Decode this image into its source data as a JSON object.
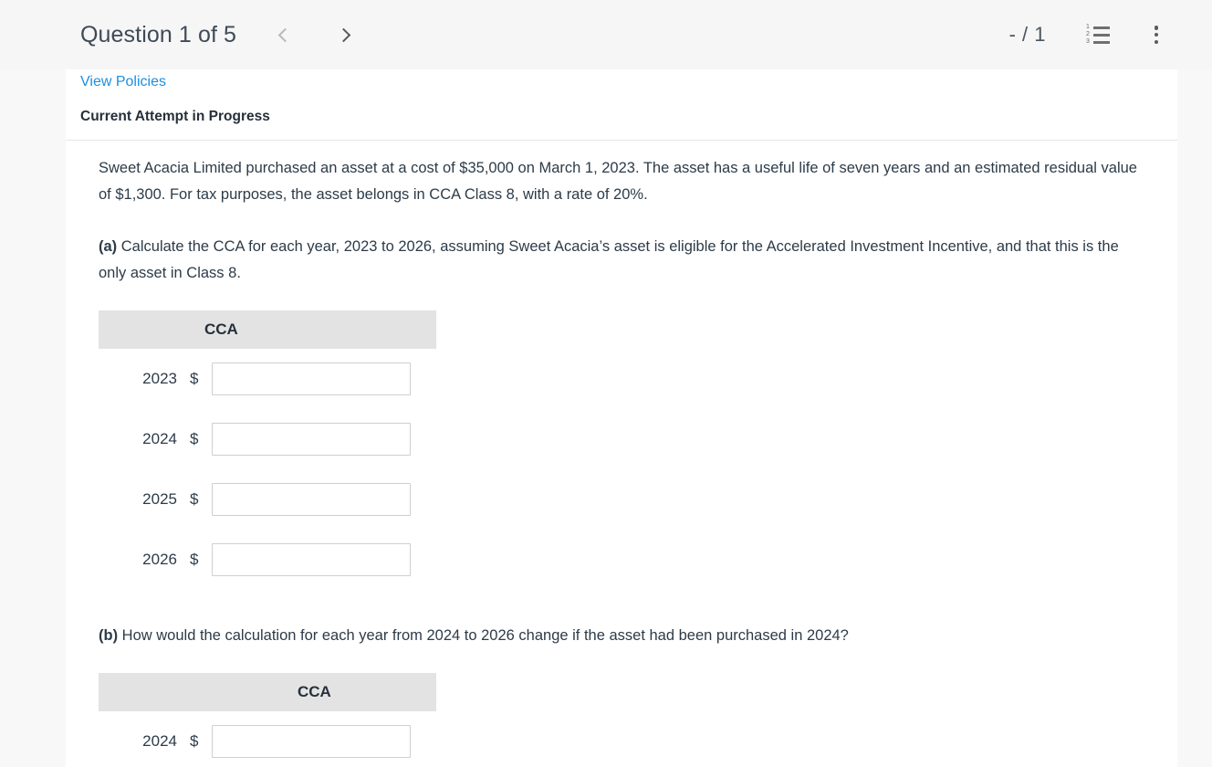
{
  "header": {
    "question_title": "Question 1 of 5",
    "prev_label": "chevron-left",
    "next_label": "chevron-right",
    "score": "- / 1",
    "list_icon_numbers": [
      "1",
      "2",
      "3"
    ],
    "list_icon_name": "numbered-list-icon",
    "menu_icon_name": "kebab-menu-icon",
    "background_color": "#f6f6f6"
  },
  "panel": {
    "policies_link": "View Policies",
    "attempt_status": "Current Attempt in Progress",
    "link_color": "#1d8fe1"
  },
  "question": {
    "stem": "Sweet Acacia Limited purchased an asset at a cost of $35,000 on March 1, 2023. The asset has a useful life of seven years and an estimated residual value of $1,300. For tax purposes, the asset belongs in CCA Class 8, with a rate of 20%.",
    "part_a_marker": "(a)",
    "part_a_text": " Calculate the CCA for each year, 2023 to 2026, assuming Sweet Acacia’s asset is eligible for the Accelerated Investment Incentive, and that this is the only asset in Class 8.",
    "part_b_marker": "(b)",
    "part_b_text": " How would the calculation for each year from 2024 to 2026 change if the asset had been purchased in 2024?"
  },
  "table_a": {
    "column_header": "CCA",
    "currency_symbol": "$",
    "rows": [
      {
        "year": "2023",
        "value": "",
        "placeholder": ""
      },
      {
        "year": "2024",
        "value": "",
        "placeholder": ""
      },
      {
        "year": "2025",
        "value": "",
        "placeholder": ""
      },
      {
        "year": "2026",
        "value": "",
        "placeholder": ""
      }
    ]
  },
  "table_b": {
    "column_header": "CCA",
    "currency_symbol": "$",
    "rows": [
      {
        "year": "2024",
        "value": "",
        "placeholder": ""
      }
    ]
  }
}
